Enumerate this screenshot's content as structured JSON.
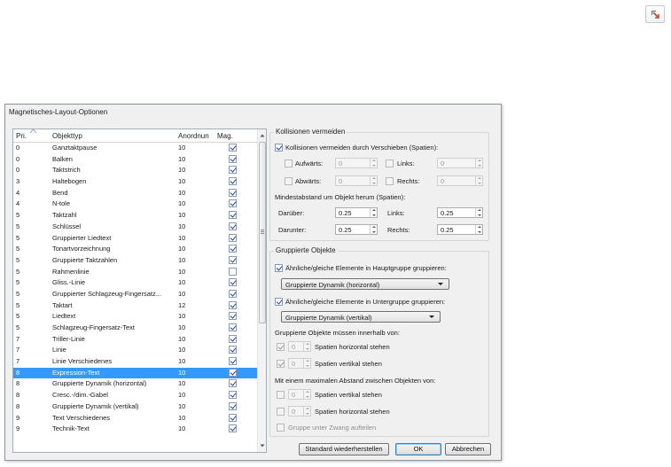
{
  "dialog": {
    "title": "Magnetisches-Layout-Optionen"
  },
  "corner_icon": "resize-arrow-icon",
  "table": {
    "headers": {
      "pri": "Pri.",
      "objekttyp": "Objekttyp",
      "anordnung": "Anordnun",
      "mag": "Mag."
    },
    "rows": [
      {
        "pri": "0",
        "typ": "Ganztaktpause",
        "ord": "10",
        "mag": true
      },
      {
        "pri": "0",
        "typ": "Balken",
        "ord": "10",
        "mag": true
      },
      {
        "pri": "0",
        "typ": "Taktstrich",
        "ord": "10",
        "mag": true
      },
      {
        "pri": "3",
        "typ": "Haltebogen",
        "ord": "10",
        "mag": true
      },
      {
        "pri": "4",
        "typ": "Bend",
        "ord": "10",
        "mag": true
      },
      {
        "pri": "4",
        "typ": "N-tole",
        "ord": "10",
        "mag": true
      },
      {
        "pri": "5",
        "typ": "Taktzahl",
        "ord": "10",
        "mag": true
      },
      {
        "pri": "5",
        "typ": "Schlüssel",
        "ord": "10",
        "mag": true
      },
      {
        "pri": "5",
        "typ": "Gruppierter Liedtext",
        "ord": "10",
        "mag": true
      },
      {
        "pri": "5",
        "typ": "Tonartvorzeichnung",
        "ord": "10",
        "mag": true
      },
      {
        "pri": "5",
        "typ": "Gruppierte Taktzahlen",
        "ord": "10",
        "mag": true
      },
      {
        "pri": "5",
        "typ": "Rahmenlinie",
        "ord": "10",
        "mag": false
      },
      {
        "pri": "5",
        "typ": "Gliss.-Linie",
        "ord": "10",
        "mag": true
      },
      {
        "pri": "5",
        "typ": "Gruppierter Schlagzeug-Fingersatz...",
        "ord": "10",
        "mag": true
      },
      {
        "pri": "5",
        "typ": "Taktart",
        "ord": "12",
        "mag": true
      },
      {
        "pri": "5",
        "typ": "Liedtext",
        "ord": "10",
        "mag": true
      },
      {
        "pri": "5",
        "typ": "Schlagzeug-Fingersatz-Text",
        "ord": "10",
        "mag": true
      },
      {
        "pri": "7",
        "typ": "Triller-Linie",
        "ord": "10",
        "mag": true
      },
      {
        "pri": "7",
        "typ": "Linie",
        "ord": "10",
        "mag": true
      },
      {
        "pri": "7",
        "typ": "Linie Verschiedenes",
        "ord": "10",
        "mag": true
      },
      {
        "pri": "8",
        "typ": "Expression-Text",
        "ord": "10",
        "mag": true,
        "selected": true
      },
      {
        "pri": "8",
        "typ": "Gruppierte Dynamik (horizontal)",
        "ord": "10",
        "mag": true
      },
      {
        "pri": "8",
        "typ": "Cresc.-/dim.-Gabel",
        "ord": "10",
        "mag": true
      },
      {
        "pri": "8",
        "typ": "Gruppierte Dynamik (vertikal)",
        "ord": "10",
        "mag": true
      },
      {
        "pri": "9",
        "typ": "Text Verschiedenes",
        "ord": "10",
        "mag": true
      },
      {
        "pri": "9",
        "typ": "Technik-Text",
        "ord": "10",
        "mag": true
      }
    ]
  },
  "kollisionen": {
    "title": "Kollisionen vermeiden",
    "main_checkbox": "Kollisionen vermeiden durch Verschieben (Spatien):",
    "main_checked": true,
    "aufwaerts_label": "Aufwärts:",
    "aufwaerts_value": "0",
    "abwaerts_label": "Abwärts:",
    "abwaerts_value": "0",
    "links_label": "Links:",
    "links_value": "0",
    "rechts_label": "Rechts:",
    "rechts_value": "0",
    "min_label": "Mindestabstand um Objekt herum (Spatien):",
    "darueber_label": "Darüber:",
    "darueber_value": "0.25",
    "links2_label": "Links:",
    "links2_value": "0.25",
    "darunter_label": "Darunter:",
    "darunter_value": "0.25",
    "rechts2_label": "Rechts:",
    "rechts2_value": "0.25"
  },
  "gruppierte": {
    "title": "Gruppierte Objekte",
    "haupt_checkbox": "Ähnliche/gleiche Elemente in Hauptgruppe gruppieren:",
    "haupt_select": "Gruppierte Dynamik (horizontal)",
    "unter_checkbox": "Ähnliche/gleiche Elemente in Untergruppe gruppieren:",
    "unter_select": "Gruppierte Dynamik (vertikal)",
    "innerhalb_label": "Gruppierte Objekte müssen innerhalb von:",
    "h_value": "0",
    "h_label": "Spatien horizontal stehen",
    "v_value": "0",
    "v_label": "Spatien vertikal stehen",
    "max_label": "Mit einem maximalen Abstand zwischen Objekten von:",
    "mv_value": "0",
    "mv_label": "Spatien vertikal stehen",
    "mh_value": "0",
    "mh_label": "Spatien horizontal stehen",
    "zwang_label": "Gruppe unter Zwang aufteilen"
  },
  "buttons": {
    "standard": "Standard wiederherstellen",
    "ok": "OK",
    "abbrechen": "Abbrechen"
  }
}
